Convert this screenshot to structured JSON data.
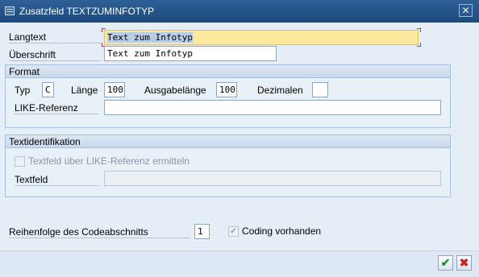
{
  "window": {
    "title": "Zusatzfeld TEXTZUMINFOTYP",
    "close_glyph": "✕"
  },
  "langtext": {
    "label": "Langtext",
    "value": "Text zum Infotyp"
  },
  "ueberschrift": {
    "label": "Überschrift",
    "value": "Text zum Infotyp"
  },
  "format": {
    "title": "Format",
    "typ_label": "Typ",
    "typ_value": "C",
    "laenge_label": "Länge",
    "laenge_value": "100",
    "ausgabe_label": "Ausgabelänge",
    "ausgabe_value": "100",
    "dezimalen_label": "Dezimalen",
    "dezimalen_value": "",
    "like_label": "LIKE-Referenz",
    "like_value": ""
  },
  "textident": {
    "title": "Textidentifikation",
    "checkbox_label": "Textfeld über LIKE-Referenz ermitteln",
    "checkbox_checked": false,
    "textfeld_label": "Textfeld",
    "textfeld_value": ""
  },
  "reihenfolge": {
    "label": "Reihenfolge des Codeabschnitts",
    "value": "1"
  },
  "coding": {
    "label": "Coding vorhanden",
    "checked": true,
    "check_glyph": "✓"
  },
  "buttons": {
    "ok_glyph": "✔",
    "cancel_glyph": "✖"
  }
}
